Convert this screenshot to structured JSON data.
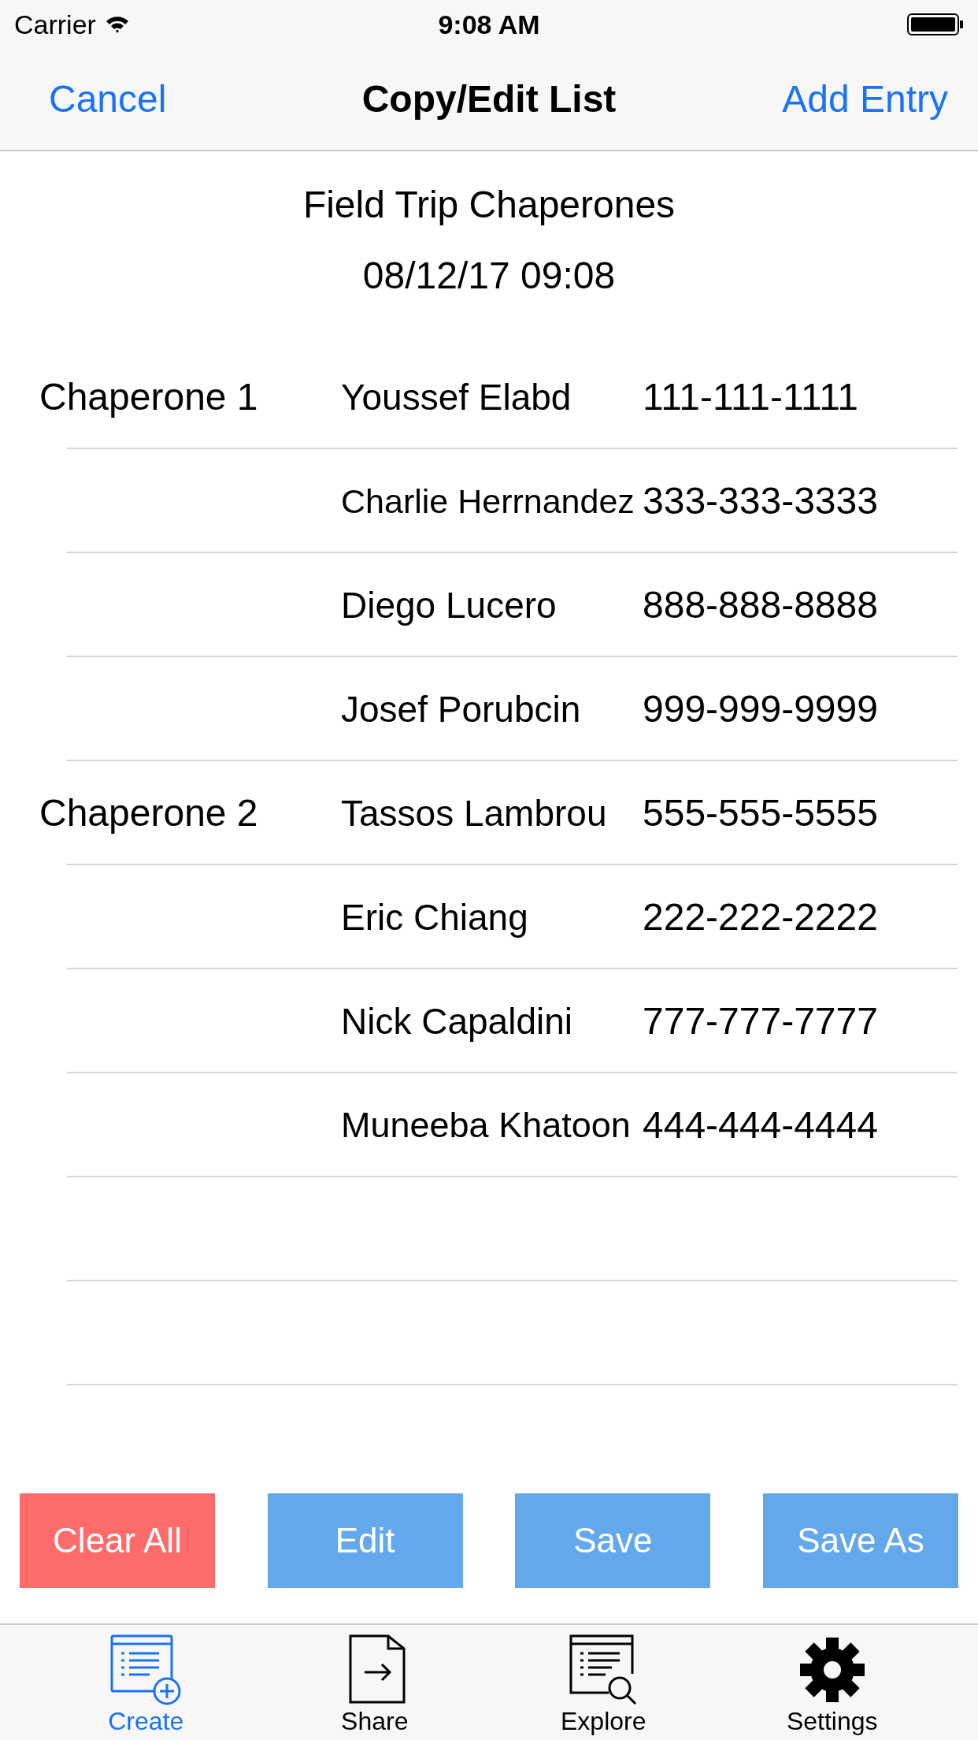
{
  "status_bar": {
    "carrier": "Carrier",
    "time": "9:08 AM"
  },
  "nav_bar": {
    "left": "Cancel",
    "title": "Copy/Edit List",
    "right": "Add Entry"
  },
  "list": {
    "title": "Field Trip Chaperones",
    "date": "08/12/17 09:08"
  },
  "groups": [
    {
      "label": "Chaperone 1",
      "entries": [
        {
          "name": "Youssef Elabd",
          "phone": "111-111-1111"
        },
        {
          "name": "Charlie Herrnandez",
          "phone": "333-333-3333"
        },
        {
          "name": "Diego Lucero",
          "phone": "888-888-8888"
        },
        {
          "name": "Josef Porubcin",
          "phone": "999-999-9999"
        }
      ]
    },
    {
      "label": "Chaperone 2",
      "entries": [
        {
          "name": "Tassos Lambrou",
          "phone": "555-555-5555"
        },
        {
          "name": "Eric Chiang",
          "phone": "222-222-2222"
        },
        {
          "name": "Nick Capaldini",
          "phone": "777-777-7777"
        },
        {
          "name": "Muneeba Khatoon",
          "phone": "444-444-4444"
        }
      ]
    }
  ],
  "buttons": [
    {
      "label": "Clear All",
      "kind": "destructive"
    },
    {
      "label": "Edit",
      "kind": "normal"
    },
    {
      "label": "Save",
      "kind": "normal"
    },
    {
      "label": "Save As",
      "kind": "normal"
    }
  ],
  "tabs": [
    {
      "label": "Create",
      "selected": true
    },
    {
      "label": "Share",
      "selected": false
    },
    {
      "label": "Explore",
      "selected": false
    },
    {
      "label": "Settings",
      "selected": false
    }
  ]
}
